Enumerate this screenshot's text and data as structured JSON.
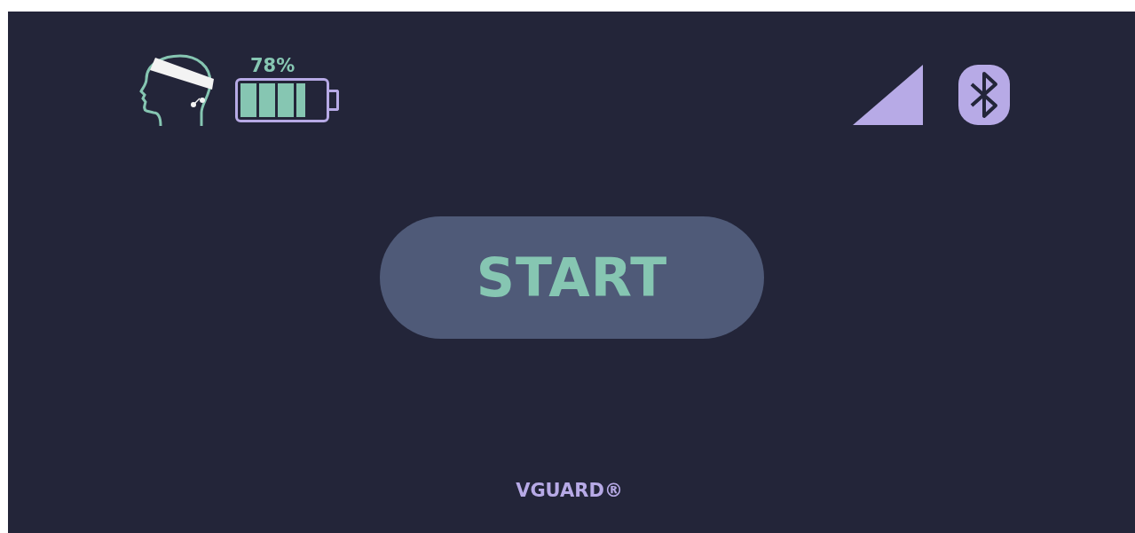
{
  "status_bar": {
    "battery": {
      "reading": "78%",
      "level": 0.78
    }
  },
  "start_button": {
    "label": "START"
  },
  "footer": {
    "brand": "VGUARD®"
  }
}
